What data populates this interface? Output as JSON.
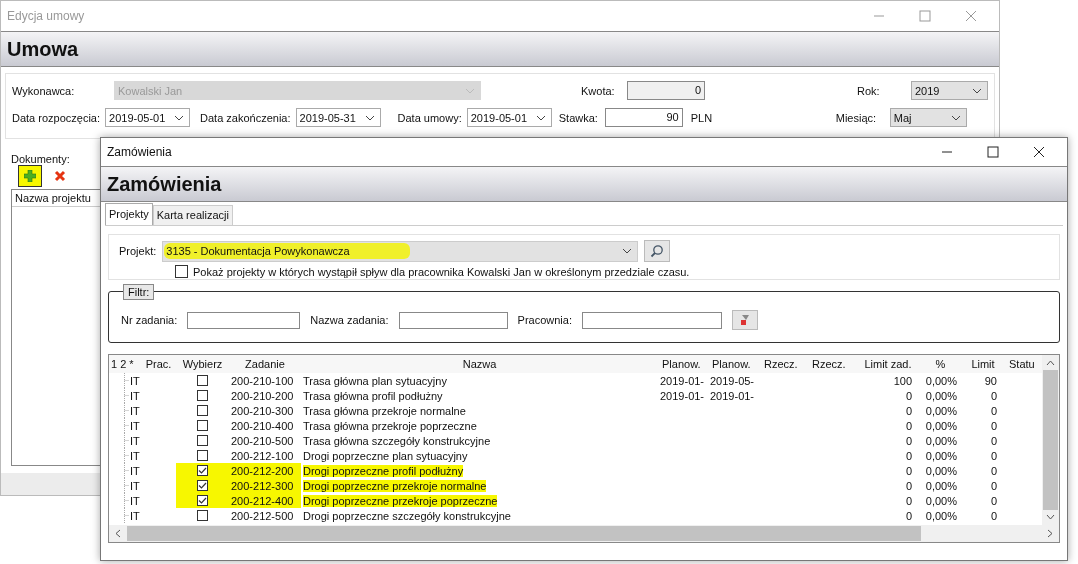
{
  "main_window": {
    "title": "Edycja umowy",
    "header": "Umowa",
    "form": {
      "wykonawca_label": "Wykonawca:",
      "wykonawca": "Kowalski Jan",
      "start_label": "Data rozpoczęcia:",
      "start": "2019-05-01",
      "end_label": "Data zakończenia:",
      "end": "2019-05-31",
      "contract_date_label": "Data umowy:",
      "contract_date": "2019-05-01",
      "kwota_label": "Kwota:",
      "kwota": "0",
      "stawka_label": "Stawka:",
      "stawka": "90",
      "currency": "PLN",
      "rok_label": "Rok:",
      "rok": "2019",
      "miesiac_label": "Miesiąc:",
      "miesiac": "Maj"
    },
    "documents": {
      "label": "Dokumenty:",
      "add_highlighted": true,
      "column": "Nazwa projektu"
    }
  },
  "dialog": {
    "title": "Zamówienia",
    "header": "Zamówienia",
    "tabs": [
      {
        "label": "Projekty",
        "selected": true
      },
      {
        "label": "Karta realizacji",
        "selected": false
      }
    ],
    "projekt_label": "Projekt:",
    "projekt": "3135 - Dokumentacja Powykonawcza",
    "projekt_highlighted": true,
    "show_checkbox": {
      "label": "Pokaż projekty w których wystąpił spływ dla pracownika Kowalski Jan w określonym przedziale czasu.",
      "checked": false
    },
    "filter": {
      "title": "Filtr:",
      "nr_label": "Nr zadania:",
      "name_label": "Nazwa zadania:",
      "dept_label": "Pracownia:"
    },
    "table": {
      "columns": [
        "1 2 *",
        "Prac.",
        "Wybierz",
        "Zadanie",
        "Nazwa",
        "Planow.",
        "Planow.",
        "Rzecz.",
        "Rzecz.",
        "Limit zad.",
        "%",
        "Limit",
        "Statu"
      ],
      "rows": [
        {
          "prac": "IT",
          "selected": false,
          "highlighted": false,
          "zadanie": "200-210-100",
          "nazwa": "Trasa główna plan sytuacyjny",
          "planow_1": "2019-01-",
          "planow_2": "2019-05-",
          "limit_zad": "100",
          "percent": "0,00%",
          "limit": "90"
        },
        {
          "prac": "IT",
          "selected": false,
          "highlighted": false,
          "zadanie": "200-210-200",
          "nazwa": "Trasa główna profil podłużny",
          "planow_1": "2019-01-",
          "planow_2": "2019-01-",
          "limit_zad": "0",
          "percent": "0,00%",
          "limit": "0"
        },
        {
          "prac": "IT",
          "selected": false,
          "highlighted": false,
          "zadanie": "200-210-300",
          "nazwa": "Trasa główna przekroje normalne",
          "limit_zad": "0",
          "percent": "0,00%",
          "limit": "0"
        },
        {
          "prac": "IT",
          "selected": false,
          "highlighted": false,
          "zadanie": "200-210-400",
          "nazwa": "Trasa główna przekroje poprzeczne",
          "limit_zad": "0",
          "percent": "0,00%",
          "limit": "0"
        },
        {
          "prac": "IT",
          "selected": false,
          "highlighted": false,
          "zadanie": "200-210-500",
          "nazwa": "Trasa główna szczegóły konstrukcyjne",
          "limit_zad": "0",
          "percent": "0,00%",
          "limit": "0"
        },
        {
          "prac": "IT",
          "selected": false,
          "highlighted": false,
          "zadanie": "200-212-100",
          "nazwa": "Drogi poprzeczne plan sytuacyjny",
          "limit_zad": "0",
          "percent": "0,00%",
          "limit": "0"
        },
        {
          "prac": "IT",
          "selected": true,
          "highlighted": true,
          "zadanie": "200-212-200",
          "nazwa": "Drogi poprzeczne profil podłużny",
          "limit_zad": "0",
          "percent": "0,00%",
          "limit": "0"
        },
        {
          "prac": "IT",
          "selected": true,
          "highlighted": true,
          "zadanie": "200-212-300",
          "nazwa": "Drogi poprzeczne przekroje normalne",
          "limit_zad": "0",
          "percent": "0,00%",
          "limit": "0"
        },
        {
          "prac": "IT",
          "selected": true,
          "highlighted": true,
          "zadanie": "200-212-400",
          "nazwa": "Drogi poprzeczne przekroje poprzeczne",
          "limit_zad": "0",
          "percent": "0,00%",
          "limit": "0"
        },
        {
          "prac": "IT",
          "selected": false,
          "highlighted": false,
          "zadanie": "200-212-500",
          "nazwa": "Drogi poprzeczne szczegóły konstrukcyjne",
          "limit_zad": "0",
          "percent": "0,00%",
          "limit": "0"
        }
      ]
    }
  }
}
